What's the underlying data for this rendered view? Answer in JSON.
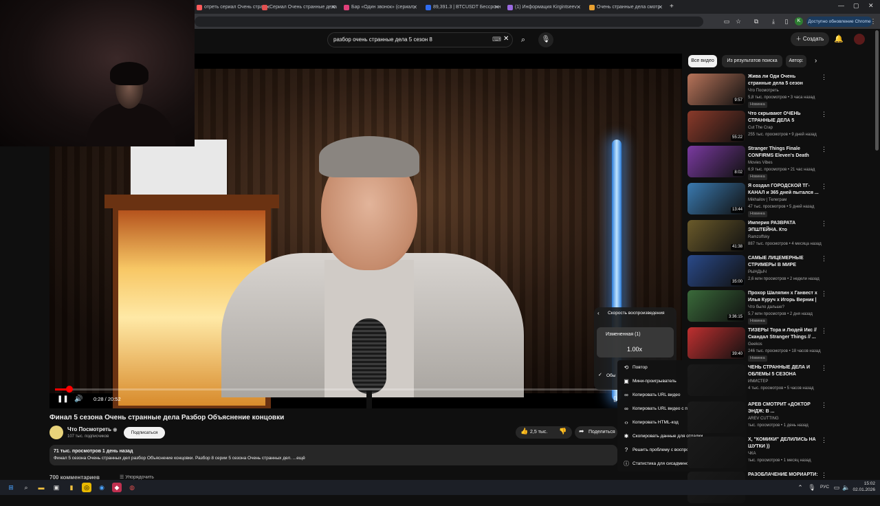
{
  "browser": {
    "tabs": [
      {
        "label": "отреть сериал Очень стран",
        "color": "#ff5a5a"
      },
      {
        "label": "Сериал Очень странные дела",
        "color": "#e05050"
      },
      {
        "label": "Бар «Один звонок» (сериал, ",
        "color": "#e0407a"
      },
      {
        "label": "89,391.3 | BTCUSDT Бессрочн",
        "color": "#2f6cf0"
      },
      {
        "label": "(1) Информация Kirgintseev",
        "color": "#9a6ae0"
      },
      {
        "label": "Очень странные дела смотр",
        "color": "#e8a030"
      }
    ],
    "new_tab": "+",
    "window_controls": [
      "—",
      "▢",
      "✕"
    ],
    "update_label": "Доступно обновление Chrome"
  },
  "youtube": {
    "search_value": "разбор очень странные дела 5 сезон 8",
    "create_label": "Создать",
    "player": {
      "time": "0:28 / 20:52",
      "progress": 0.022,
      "speed_menu": {
        "title": "Скорость воспроизведения",
        "custom_label": "Измененная (1)",
        "value": "1.00x",
        "normal_label": "Обы"
      },
      "context_menu": [
        {
          "icon": "loop-icon",
          "glyph": "⟲",
          "label": "Повтор"
        },
        {
          "icon": "miniplayer-icon",
          "glyph": "▣",
          "label": "Мини-проигрыватель"
        },
        {
          "icon": "link-icon",
          "glyph": "∞",
          "label": "Копировать URL видео"
        },
        {
          "icon": "link-time-icon",
          "glyph": "∞",
          "label": "Копировать URL видео с привязкой ко времени"
        },
        {
          "icon": "code-icon",
          "glyph": "‹›",
          "label": "Копировать HTML-код"
        },
        {
          "icon": "debug-icon",
          "glyph": "✱",
          "label": "Скопировать данные для отладки"
        },
        {
          "icon": "help-icon",
          "glyph": "?",
          "label": "Решить проблему с воспроизведением"
        },
        {
          "icon": "info-icon",
          "glyph": "ⓘ",
          "label": "Статистика для сисадминов"
        }
      ]
    },
    "video": {
      "title": "Финал 5 сезона Очень странные дела Разбор Объяснение концовки",
      "channel": "Что Посмотреть",
      "subscribers": "107 тыс. подписчиков",
      "subscribe_label": "Подписаться",
      "likes": "2,5 тыс.",
      "share_label": "Поделиться",
      "stats": "71 тыс. просмотров  1 день назад",
      "description": "Финал 5 сезона Очень странных дел разбор Объяснение концовки. Разбор 8 серии 5 сезона Очень странных дел. ...ещё",
      "comments_peek": "700 комментариев",
      "sort_peek": "Упорядочить"
    },
    "chips": [
      "Все видео",
      "Из результатов поиска",
      "Автор:"
    ],
    "recommendations": [
      {
        "title": "Жива ли Оди Очень странные дела 5 сезон",
        "channel": "Что Посмотреть",
        "meta": "5,8 тыс. просмотров • 3 часа назад",
        "badge": "Новинка",
        "duration": "9:57",
        "thumb": "#b8745a"
      },
      {
        "title": "Что скрывают ОЧЕНЬ СТРАННЫЕ ДЕЛА 5",
        "channel": "Cut The Crap",
        "meta": "255 тыс. просмотров • 9 дней назад",
        "badge": "",
        "duration": "55:22",
        "thumb": "#8a3a2a"
      },
      {
        "title": "Stranger Things Finale CONFIRMS Eleven's Death Thi...",
        "channel": "Movies Vibes",
        "meta": "6,9 тыс. просмотров • 21 час назад",
        "badge": "Новинка",
        "duration": "8:02",
        "thumb": "#7a3aa0"
      },
      {
        "title": "Я создал ГОРОДСКОЙ ТГ-КАНАЛ и 365 дней пытался ...",
        "channel": "Mikhailov | Телеграм",
        "meta": "47 тыс. просмотров • 5 дней назад",
        "badge": "Новинка",
        "duration": "13:44",
        "thumb": "#3a7ab0"
      },
      {
        "title": "Империя РАЗВРАТА ЭПШТЕЙНА. Кто пользовалс...",
        "channel": "Ramzoffsky",
        "meta": "887 тыс. просмотров • 4 месяца назад",
        "badge": "",
        "duration": "41:38",
        "thumb": "#6a5a2a"
      },
      {
        "title": "САМЫЕ ЛИЦЕМЕРНЫЕ СТРИМЕРЫ В МИРЕ",
        "channel": "РЫНДЫЧ",
        "meta": "2,6 млн просмотров • 2 недели назад",
        "badge": "",
        "duration": "35:00",
        "thumb": "#2a4a8a"
      },
      {
        "title": "Прохор Шаляпин х Ганвест х Илья Куруч х Игорь Верник | ...",
        "channel": "Что было дальше?",
        "meta": "5,7 млн просмотров • 2 дня назад",
        "badge": "Новинка",
        "duration": "3:36:15",
        "thumb": "#3a6a3a"
      },
      {
        "title": "ТИЗЕРЫ Тора и Людей Икс // Скандал Stranger Things // ...",
        "channel": "Geekos",
        "meta": "246 тыс. просмотров • 18 часов назад",
        "badge": "Новинка",
        "duration": "39:40",
        "thumb": "#c03030"
      },
      {
        "title": "ЧЕНЬ СТРАННЫЕ ДЕЛА И ОБЛЕМЫ 5 СЕЗОНА",
        "channel": "ИМИСТЕР",
        "meta": "4 тыс. просмотров • 5 часов назад",
        "badge": "",
        "duration": "",
        "thumb": "#1a1a1a"
      },
      {
        "title": "АРЕВ СМОТРИТ «ДОКТОР ЭНДЖ: В ...",
        "channel": "AREV CUTTING",
        "meta": "тыс. просмотров • 1 день назад",
        "badge": "",
        "duration": "",
        "thumb": "#1a1a1a"
      },
      {
        "title": "Х, \"КОМИКИ\" ДЕЛИЛИСЬ НА ШУТКИ ))",
        "channel": "ЧКА",
        "meta": "тыс. просмотров • 1 месяц назад",
        "badge": "",
        "duration": "",
        "thumb": "#1a1a1a"
      },
      {
        "title": "РАЗОБЛАЧЕНИЕ МОРИАРТИ:",
        "channel": "",
        "meta": "",
        "badge": "",
        "duration": "",
        "thumb": "#1a1a1a"
      }
    ]
  },
  "taskbar": {
    "lang": "РУС",
    "time": "15:02",
    "date": "02.01.2026"
  }
}
